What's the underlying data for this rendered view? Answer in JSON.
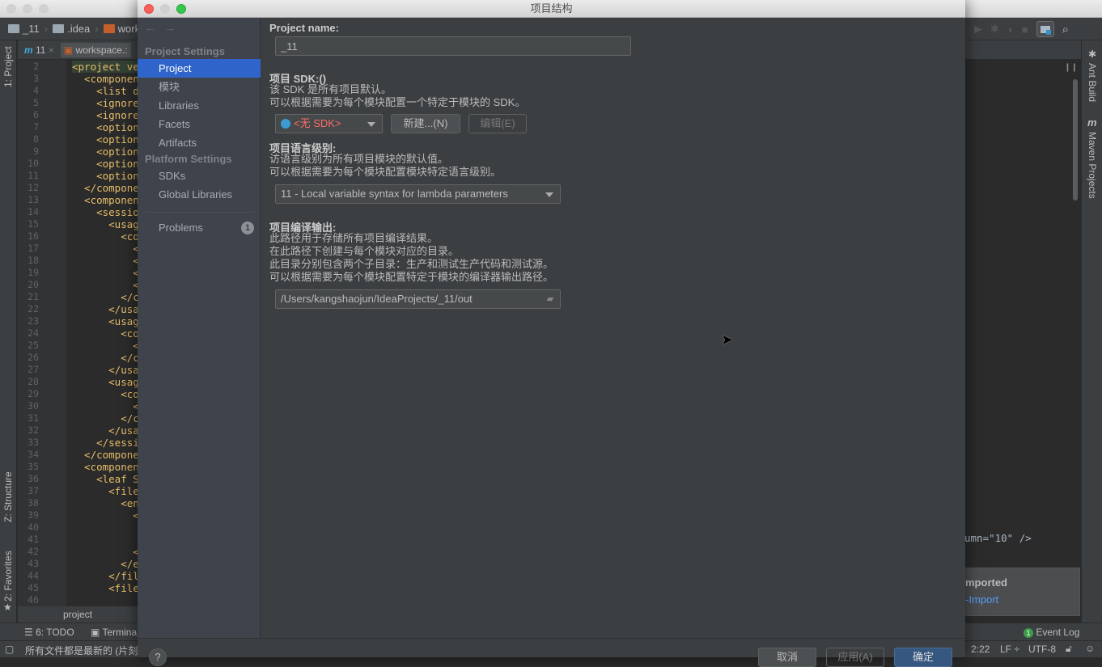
{
  "ide": {
    "breadcrumbs": [
      "_11",
      ".idea",
      "works"
    ],
    "tabs": [
      {
        "label": "11",
        "icon": "maven-icon"
      },
      {
        "label": "workspace.:",
        "icon": "xml-file-icon"
      }
    ],
    "left_tool_windows": [
      "1: Project",
      "Z: Structure",
      "2: Favorites"
    ],
    "right_tool_windows": [
      "Ant Build",
      "Maven Projects"
    ],
    "line_numbers": [
      2,
      3,
      4,
      5,
      6,
      7,
      8,
      9,
      10,
      11,
      12,
      13,
      14,
      15,
      16,
      17,
      18,
      19,
      20,
      21,
      22,
      23,
      24,
      25,
      26,
      27,
      28,
      29,
      30,
      31,
      32,
      33,
      34,
      35,
      36,
      37,
      38,
      39,
      40,
      41,
      42,
      43,
      44,
      45,
      46
    ],
    "code_lines": [
      "<project ve",
      "  <component",
      "    <list de",
      "    <ignored",
      "    <ignored",
      "    <option",
      "    <option",
      "    <option",
      "    <option",
      "    <option",
      "  </componen",
      "  <component",
      "    <session",
      "      <usage",
      "        <cou",
      "          <e",
      "          <e",
      "          <e",
      "          <e",
      "        </c",
      "      </usag",
      "      <usage",
      "        <cou",
      "          <e",
      "        </c",
      "      </usag",
      "      <usage",
      "        <cou",
      "          <e",
      "        </c",
      "      </usag",
      "    </sessio",
      "  </componen",
      "  <component",
      "    <leaf SI",
      "      <file",
      "        <en",
      "          <p",
      "",
      "",
      "          </",
      "        </en",
      "      </file",
      "      <file"
    ],
    "editor_footer": "project",
    "code_right": "umn=\"10\" />",
    "bottom_tools": {
      "todo": "6: TODO",
      "terminal": "Termina",
      "event_log": "Event Log",
      "event_count": "1"
    },
    "status": {
      "message": "所有文件都是最新的 (片刻之",
      "position": "2:22",
      "line_sep": "LF ÷",
      "encoding": "UTF-8"
    },
    "popup": {
      "title": "mported",
      "link": "-Import"
    }
  },
  "dialog": {
    "title": "项目结构",
    "nav": {
      "back": "←",
      "forward": "→"
    },
    "sidebar": {
      "project_settings_header": "Project Settings",
      "project_items": [
        "Project",
        "模块",
        "Libraries",
        "Facets",
        "Artifacts"
      ],
      "platform_settings_header": "Platform Settings",
      "platform_items": [
        "SDKs",
        "Global Libraries"
      ],
      "problems": "Problems",
      "problems_count": "1",
      "selected": "Project"
    },
    "project_name": {
      "label": "Project name:",
      "value": "_11"
    },
    "sdk": {
      "label": "项目 SDK:()",
      "desc1": "该 SDK 是所有项目默认。",
      "desc2": "可以根据需要为每个模块配置一个特定于模块的 SDK。",
      "selected": "<无 SDK>",
      "new_button": "新建...(N)",
      "edit_button": "编辑(E)"
    },
    "language_level": {
      "label": "项目语言级别:",
      "desc1": "访语言级别为所有项目模块的默认值。",
      "desc2": "可以根据需要为每个模块配置模块特定语言级别。",
      "selected": "11 - Local variable syntax for lambda parameters"
    },
    "compiler_output": {
      "label": "项目编译输出:",
      "desc1": "此路径用于存储所有项目编译结果。",
      "desc2": "在此路径下创建与每个模块对应的目录。",
      "desc3": "此目录分别包含两个子目录：生产和测试生产代码和测试源。",
      "desc4": "可以根据需要为每个模块配置特定于模块的编译器输出路径。",
      "path": "/Users/kangshaojun/IdeaProjects/_11/out"
    },
    "buttons": {
      "help": "?",
      "cancel": "取消",
      "apply": "应用(A)",
      "ok": "确定"
    },
    "colors": {
      "accent": "#2f65ca",
      "error_text": "#ff6b68",
      "ok_button": "#365880"
    }
  }
}
